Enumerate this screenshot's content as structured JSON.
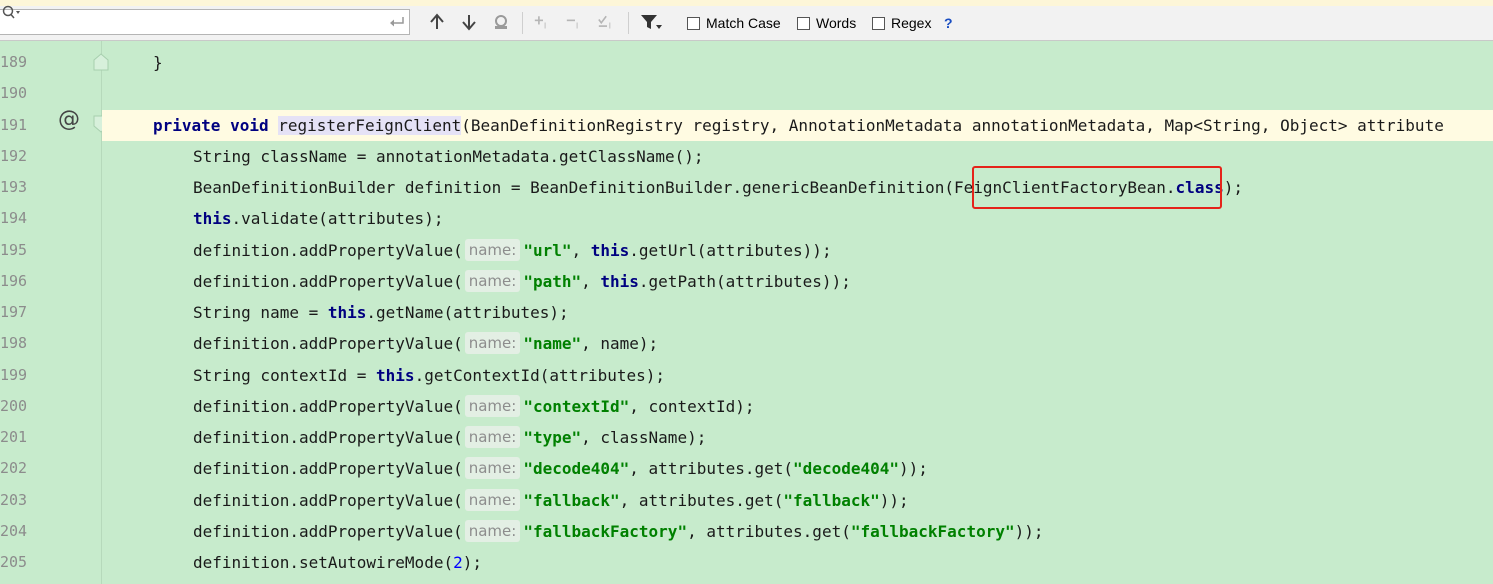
{
  "find_bar": {
    "search_value": "",
    "toolbar_icons": [
      "search-icon",
      "enter-icon",
      "arrow-up-icon",
      "arrow-down-icon",
      "find-all-icon",
      "add-occurrence-icon",
      "remove-occurrence-icon",
      "select-all-occurrences-icon",
      "filter-icon"
    ],
    "match_case_label": "Match Case",
    "words_label": "Words",
    "regex_label": "Regex",
    "help_label": "?"
  },
  "gutter": {
    "line_numbers": [
      "189",
      "190",
      "191",
      "192",
      "193",
      "194",
      "195",
      "196",
      "197",
      "198",
      "199",
      "200",
      "201",
      "202",
      "203",
      "204",
      "205"
    ],
    "annotation_symbol": "@"
  },
  "code": {
    "l189": {
      "brace": "}"
    },
    "l191": {
      "kw1": "private",
      "kw2": "void",
      "method": "registerFeignClient",
      "params": "(BeanDefinitionRegistry registry, AnnotationMetadata annotationMetadata, Map<String, Object> attribute"
    },
    "l192": {
      "text": "String className = annotationMetadata.getClassName();"
    },
    "l193": {
      "pre": "BeanDefinitionBuilder definition = BeanDefinitionBuilder.genericBeanDefinition",
      "arg": "(FeignClientFactoryBean.",
      "kw": "class",
      "post": ");"
    },
    "l194": {
      "kw": "this",
      "post": ".validate(attributes);"
    },
    "hint_label": "name:",
    "add_prop": "definition.addPropertyValue(",
    "l195": {
      "str": "\"url\"",
      "sep": ", ",
      "kw": "this",
      "post": ".getUrl(attributes));"
    },
    "l196": {
      "str": "\"path\"",
      "sep": ", ",
      "kw": "this",
      "post": ".getPath(attributes));"
    },
    "l197": {
      "pre": "String name = ",
      "kw": "this",
      "post": ".getName(attributes);"
    },
    "l198": {
      "str": "\"name\"",
      "post": ", name);"
    },
    "l199": {
      "pre": "String contextId = ",
      "kw": "this",
      "post": ".getContextId(attributes);"
    },
    "l200": {
      "str": "\"contextId\"",
      "post": ", contextId);"
    },
    "l201": {
      "str": "\"type\"",
      "post": ", className);"
    },
    "l202": {
      "str": "\"decode404\"",
      "mid": ", attributes.get(",
      "str2": "\"decode404\"",
      "post": "));"
    },
    "l203": {
      "str": "\"fallback\"",
      "mid": ", attributes.get(",
      "str2": "\"fallback\"",
      "post": "));"
    },
    "l204": {
      "str": "\"fallbackFactory\"",
      "mid": ", attributes.get(",
      "str2": "\"fallbackFactory\"",
      "post": "));"
    },
    "l205": {
      "pre": "definition.setAutowireMode(",
      "num": "2",
      "post": ");"
    }
  },
  "colors": {
    "editor_background": "#c7ebcc",
    "current_line": "#fffbe2",
    "keyword": "#000080",
    "string": "#008000",
    "number": "#0000ff",
    "highlight_box": "#e5231a"
  }
}
